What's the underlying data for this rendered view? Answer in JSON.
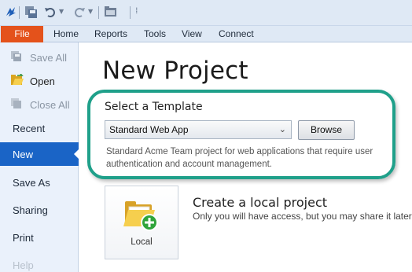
{
  "ribbon": {
    "tabs": [
      {
        "label": "File",
        "active": true
      },
      {
        "label": "Home"
      },
      {
        "label": "Reports"
      },
      {
        "label": "Tools"
      },
      {
        "label": "View"
      },
      {
        "label": "Connect"
      }
    ],
    "file_color": "#e4521b"
  },
  "quick_access": {
    "icons": [
      "app-logo-icon",
      "save-all-icon",
      "undo-icon",
      "redo-icon",
      "open-folder-icon",
      "customize-icon"
    ]
  },
  "nav": {
    "commands": [
      {
        "label": "Save All",
        "icon": "save-all-icon",
        "enabled": false
      },
      {
        "label": "Open",
        "icon": "open-icon",
        "enabled": true
      },
      {
        "label": "Close All",
        "icon": "close-all-icon",
        "enabled": false
      }
    ],
    "sections": [
      {
        "label": "Recent"
      },
      {
        "label": "New",
        "selected": true
      },
      {
        "label": "Save As"
      },
      {
        "label": "Sharing"
      },
      {
        "label": "Print"
      },
      {
        "label": "Help"
      }
    ],
    "selected_color": "#1a64c6"
  },
  "main": {
    "title": "New Project",
    "template": {
      "label": "Select a Template",
      "selected": "Standard Web App",
      "browse_label": "Browse",
      "description": "Standard Acme Team project for web applications that require user authentication and account management."
    },
    "options": [
      {
        "tile_label": "Local",
        "title": "Create a local project",
        "subtitle": "Only you will have access, but you may share it later",
        "icon": "local-folder-add-icon"
      }
    ],
    "highlight_color": "#1fa08a"
  }
}
